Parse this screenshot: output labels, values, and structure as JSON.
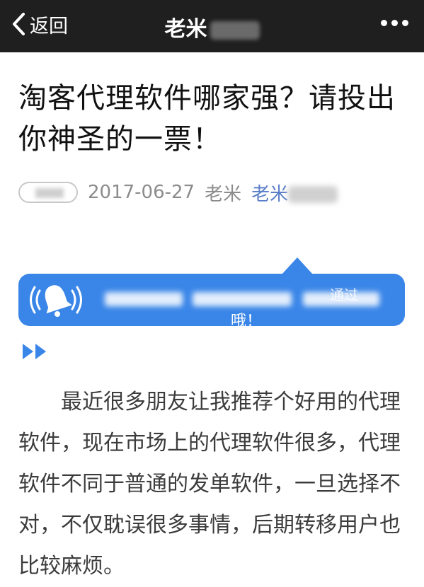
{
  "nav": {
    "back_label": "返回",
    "title": "老米"
  },
  "article": {
    "title": "淘客代理软件哪家强？请投出你神圣的一票！",
    "date": "2017-06-27",
    "author": "老米",
    "account": "老米"
  },
  "notice": {
    "text_tail": "通过",
    "text_line2": "哦！"
  },
  "body": {
    "paragraph": "最近很多朋友让我推荐个好用的代理软件，现在市场上的代理软件很多，代理软件不同于普通的发单软件，一旦选择不对，不仅耽误很多事情，后期转移用户也比较麻烦。"
  },
  "colors": {
    "topbar": "#1f1f1f",
    "notice_blue": "#3a86e8",
    "link_blue": "#5a7ec7",
    "meta_gray": "#8c8c8c"
  }
}
